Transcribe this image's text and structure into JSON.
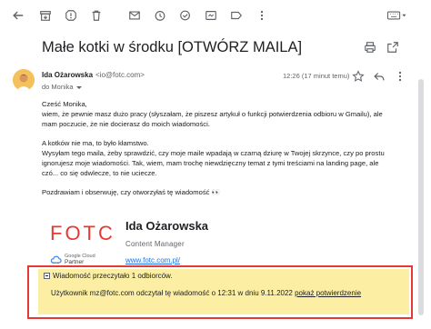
{
  "toolbar": {
    "icons": [
      "back-arrow-icon",
      "archive-icon",
      "report-spam-icon",
      "delete-icon",
      "mark-unread-icon",
      "snooze-icon",
      "add-to-tasks-icon",
      "move-to-icon",
      "label-icon",
      "more-icon",
      "keyboard-icon"
    ]
  },
  "email": {
    "subject": "Małe kotki w środku [OTWÓRZ MAILA]",
    "sender_name": "Ida Ożarowska",
    "sender_email": "<io@fotc.com>",
    "to_line": "do Monika",
    "time": "12:26 (17 minut temu)",
    "body": {
      "greeting": "Cześć Monika,",
      "para1": "wiem, że pewnie masz dużo pracy (słyszałam, że piszesz artykuł o funkcji potwierdzenia odbioru w Gmailu), ale mam poczucie, że nie docierasz do moich wiadomości.",
      "para2_line1": "A kotków nie ma, to było kłamstwo.",
      "para2_rest": "Wysyłam tego maila, żeby sprawdzić, czy moje maile wpadają w czarną dziurę w Twojej skrzynce, czy po prostu ignorujesz moje wiadomości. Tak, wiem, mam trochę niewdzięczny temat z tymi treściami na landing page, ale czó... co się odwlecze, to nie uciecze.",
      "closing": "Pozdrawiam i obserwuję, czy otworzyłaś tę wiadomość 👀"
    }
  },
  "signature": {
    "logo_text": "FOTC",
    "badge_line1": "Google Cloud",
    "badge_line2": "Partner",
    "name": "Ida Ożarowska",
    "title": "Content Manager",
    "link": "www.fotc.com.pl/"
  },
  "read_receipt": {
    "header": "Wiadomość przeczytało 1 odbiorców.",
    "line_prefix": "Użytkownik mz@fotc.com odczytał tę wiadomość o 12:31 w dniu 9.11.2022",
    "link_label": "pokaż potwierdzenie"
  },
  "colors": {
    "highlight": "#fcefa3",
    "annotation_border": "#e53935",
    "link": "#1a73e8",
    "logo_red": "#e53935"
  }
}
